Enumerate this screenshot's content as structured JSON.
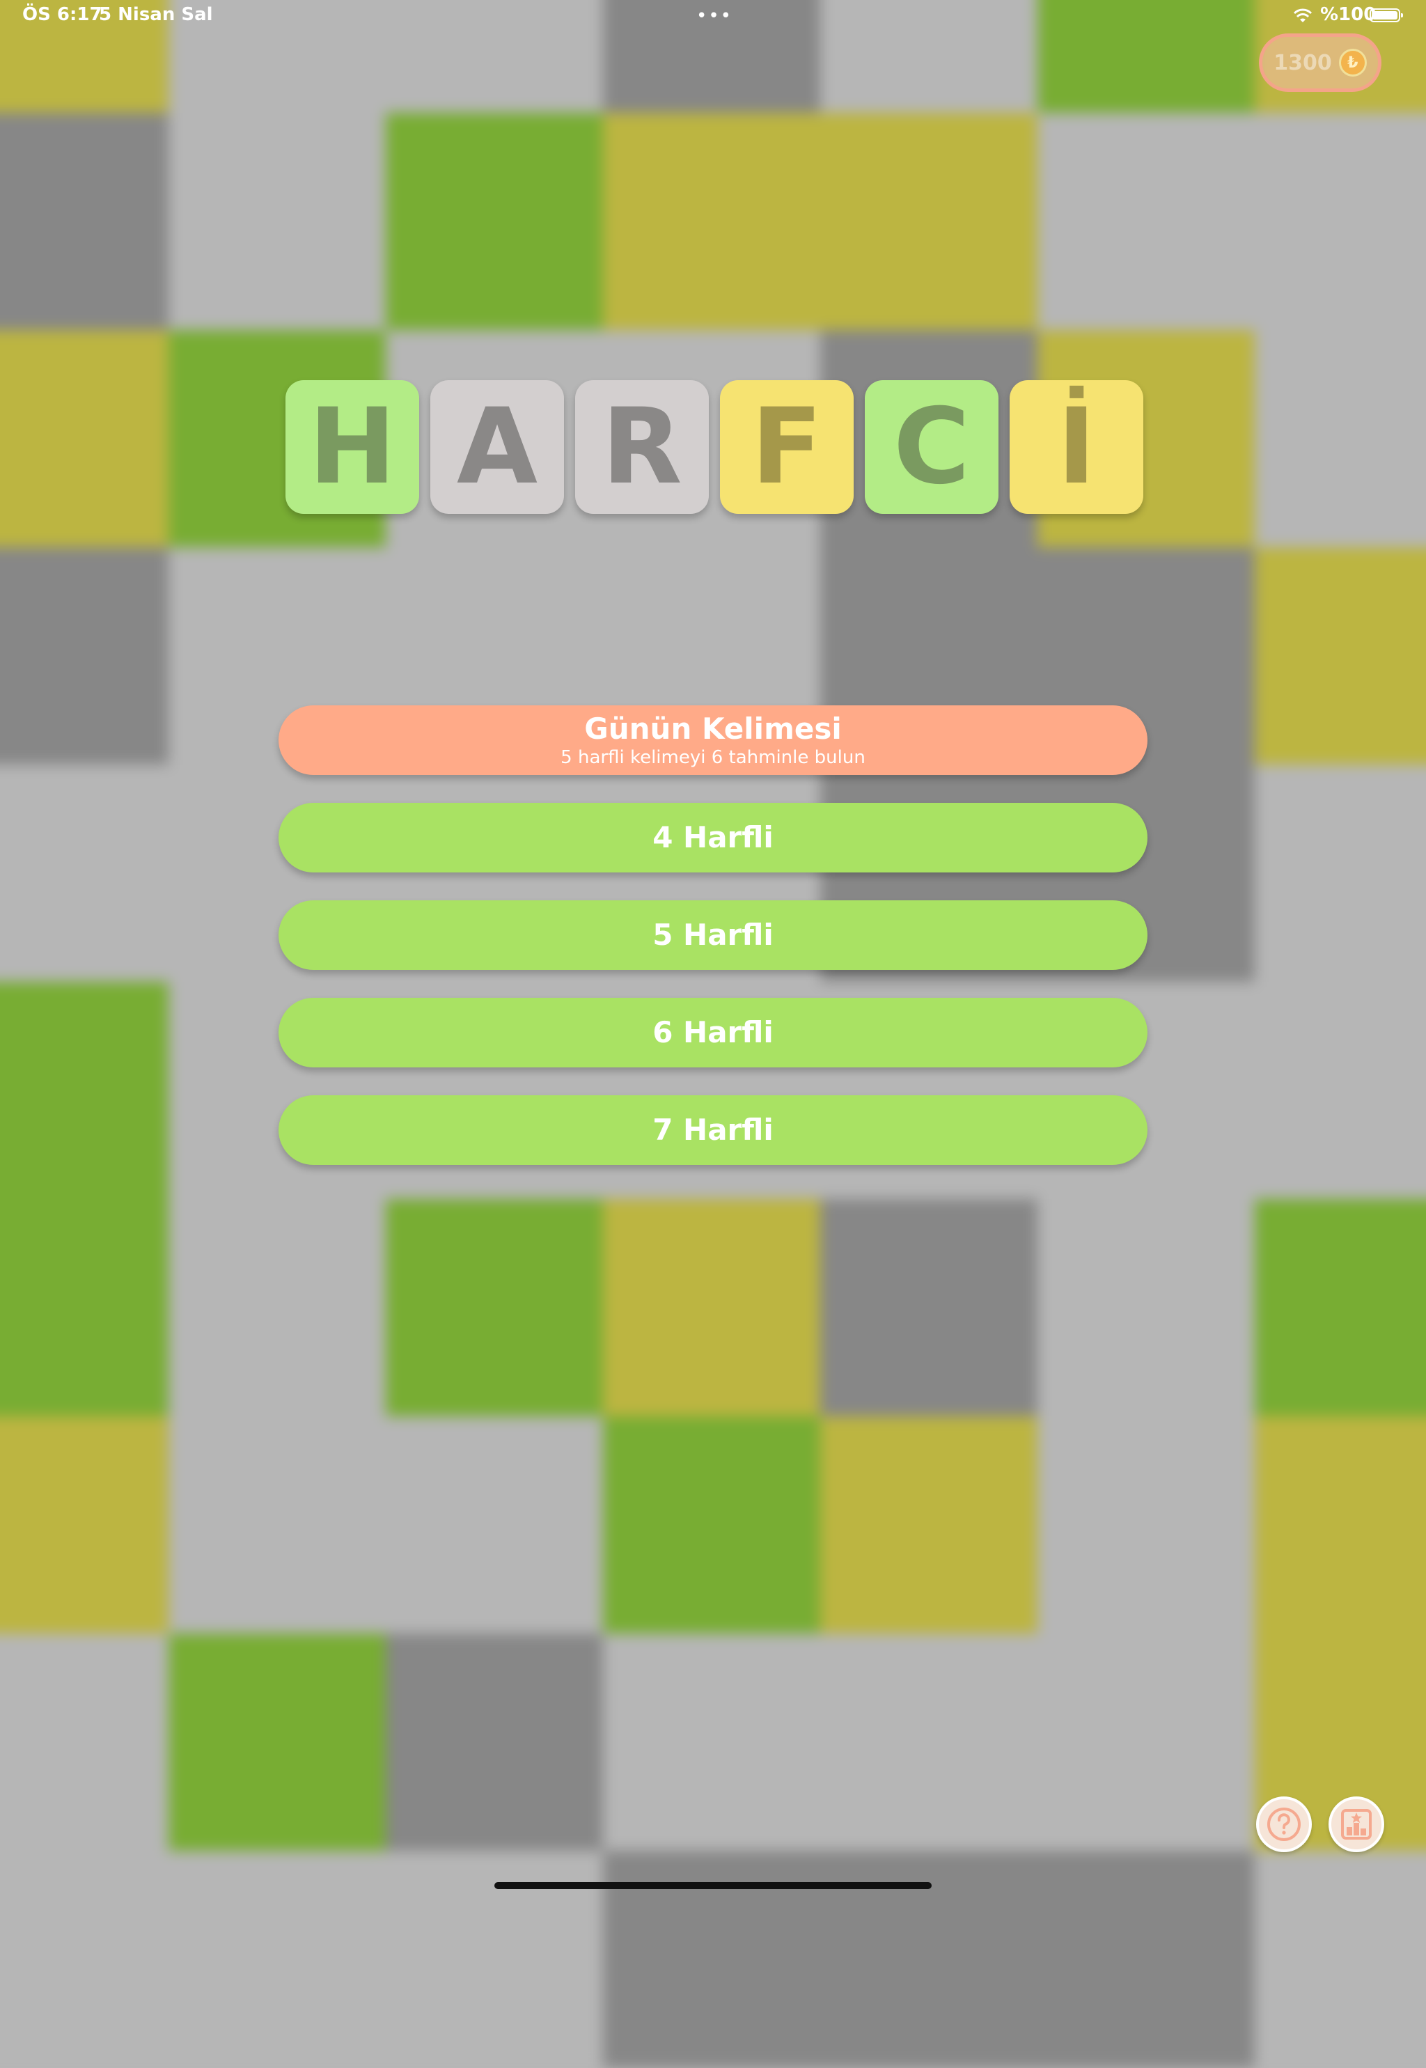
{
  "status_bar": {
    "time": "ÖS 6:17",
    "date": "5 Nisan Sal",
    "dots": "•••",
    "battery": "%100",
    "icons": [
      "wifi-icon",
      "battery-icon"
    ]
  },
  "coins": {
    "value": "1300",
    "symbol": "₺"
  },
  "title": {
    "letters": [
      "H",
      "A",
      "R",
      "F",
      "C",
      "İ"
    ]
  },
  "menu": {
    "daily": {
      "title": "Günün Kelimesi",
      "subtitle": "5 harfli kelimeyi 6 tahminle bulun"
    },
    "four": "4 Harfli",
    "five": "5 Harfli",
    "six": "6 Harfli",
    "seven": "7 Harfli"
  },
  "bottom_icons": [
    "question-icon",
    "leaderboard-icon"
  ],
  "colors": {
    "green_tile": "#b3ec86",
    "gray_tile": "#d3cfcf",
    "yellow_tile": "#f6e371",
    "daily_button": "#ffaa88",
    "mode_button": "#a9e263"
  }
}
